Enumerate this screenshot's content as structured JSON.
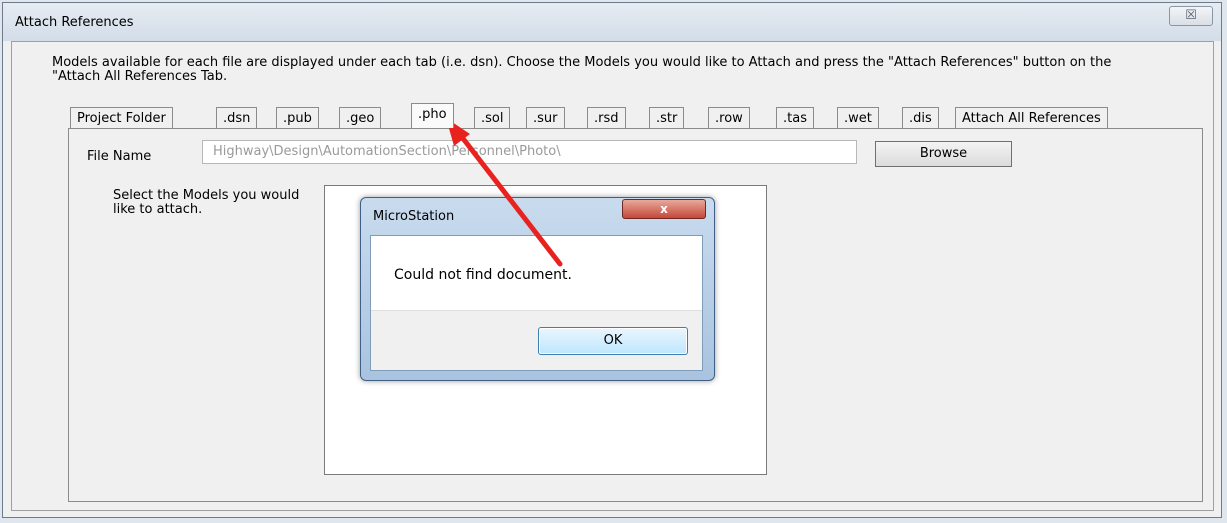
{
  "window": {
    "title": "Attach References",
    "close_glyph": "☒"
  },
  "instructions": "Models available for each file are displayed under each tab (i.e. dsn).  Choose the Models you would like to Attach and press the \"Attach References\" button on the \"Attach All References Tab.",
  "tabs": [
    "Project Folder",
    ".dsn",
    ".pub",
    ".geo",
    ".pho",
    ".sol",
    ".sur",
    ".rsd",
    ".str",
    ".row",
    ".tas",
    ".wet",
    ".dis",
    "Attach All References"
  ],
  "active_tab": ".pho",
  "file_name": {
    "label": "File Name",
    "value": "Highway\\Design\\AutomationSection\\Personnel\\Photo\\"
  },
  "browse_label": "Browse",
  "models_label": "Select the Models you would like to attach.",
  "dialog": {
    "title": "MicroStation",
    "close_glyph": "x",
    "message": "Could not find document.",
    "ok_label": "OK"
  },
  "annotation_color": "#e8231f"
}
